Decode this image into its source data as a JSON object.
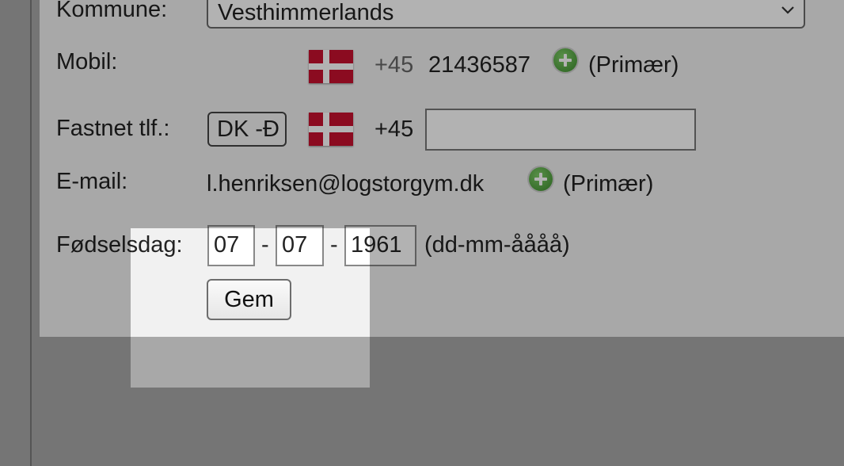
{
  "form": {
    "kommune": {
      "label": "Kommune:",
      "value": "Vesthimmerlands"
    },
    "mobil": {
      "label": "Mobil:",
      "prefix": "+45",
      "number": "21436587",
      "primary": "(Primær)"
    },
    "fastnet": {
      "label": "Fastnet tlf.:",
      "country": "DK -Ð",
      "prefix": "+45",
      "value": ""
    },
    "email": {
      "label": "E-mail:",
      "value": "l.henriksen@logstorgym.dk",
      "primary": "(Primær)"
    },
    "birthday": {
      "label": "Fødselsdag:",
      "day": "07",
      "month": "07",
      "year": "1961",
      "separator": "-",
      "format": "(dd-mm-åååå)"
    },
    "save_label": "Gem"
  },
  "icons": {
    "flag": "denmark-flag-icon",
    "add": "green-plus-icon",
    "dropdown": "chevron-down-icon"
  },
  "colors": {
    "flag_red": "#c8102e",
    "add_green": "#4caf3c"
  }
}
